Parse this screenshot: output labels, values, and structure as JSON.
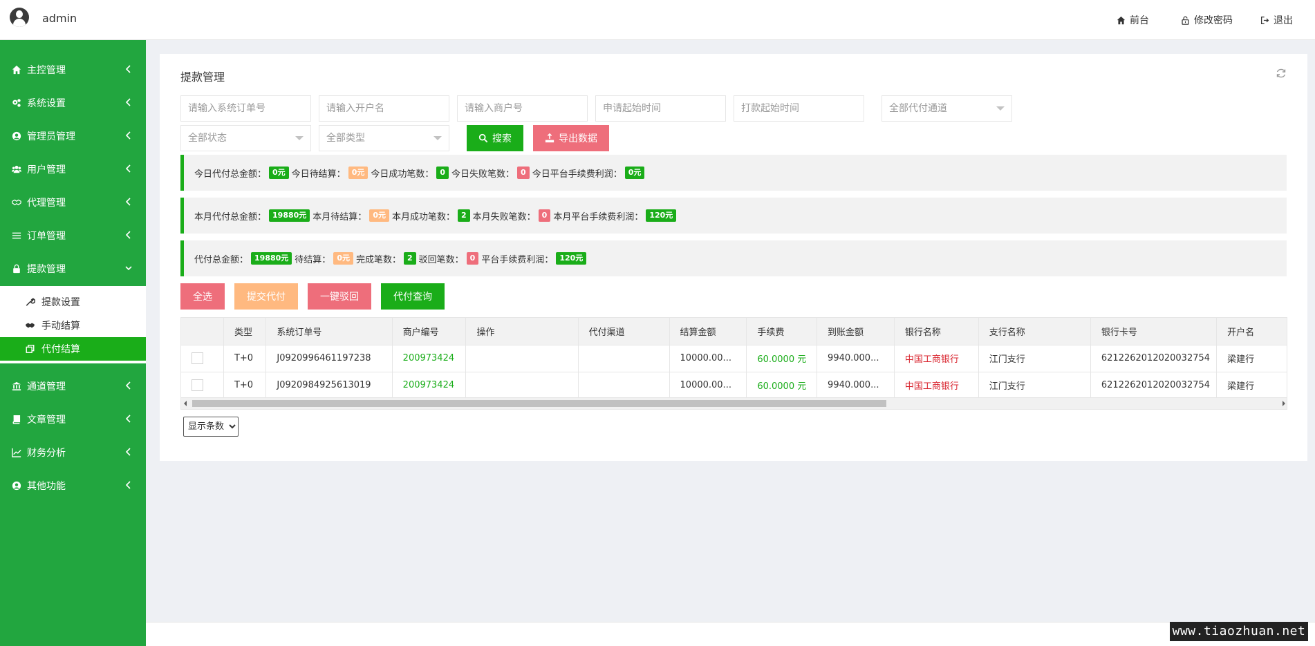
{
  "header": {
    "username": "admin",
    "links": [
      {
        "label": "前台",
        "icon": "home-icon"
      },
      {
        "label": "修改密码",
        "icon": "lock-icon"
      },
      {
        "label": "退出",
        "icon": "logout-icon"
      }
    ]
  },
  "sidebar": {
    "items": [
      {
        "label": "主控管理",
        "icon": "home-icon"
      },
      {
        "label": "系统设置",
        "icon": "gears-icon"
      },
      {
        "label": "管理员管理",
        "icon": "user-circle-icon"
      },
      {
        "label": "用户管理",
        "icon": "users-icon"
      },
      {
        "label": "代理管理",
        "icon": "handshake-icon"
      },
      {
        "label": "订单管理",
        "icon": "list-icon"
      },
      {
        "label": "提款管理",
        "icon": "lock-icon"
      },
      {
        "label": "通道管理",
        "icon": "bank-icon"
      },
      {
        "label": "文章管理",
        "icon": "book-icon"
      },
      {
        "label": "财务分析",
        "icon": "chart-icon"
      },
      {
        "label": "其他功能",
        "icon": "user-circle-icon"
      }
    ],
    "submenu": [
      {
        "label": "提款设置",
        "icon": "wrench-icon"
      },
      {
        "label": "手动结算",
        "icon": "handshake-icon"
      },
      {
        "label": "代付结算",
        "icon": "clone-icon"
      }
    ]
  },
  "panel": {
    "title": "提款管理"
  },
  "filters": {
    "order_no_placeholder": "请输入系统订单号",
    "account_name_placeholder": "请输入开户名",
    "merchant_no_placeholder": "请输入商户号",
    "apply_time_placeholder": "申请起始时间",
    "pay_time_placeholder": "打款起始时间",
    "channel_select": "全部代付通道",
    "status_select": "全部状态",
    "type_select": "全部类型",
    "search_label": "搜索",
    "export_label": "导出数据"
  },
  "stats": {
    "today": [
      {
        "label": "今日代付总金额：",
        "value": "0元",
        "color": "green"
      },
      {
        "label": "今日待结算：",
        "value": "0元",
        "color": "orange"
      },
      {
        "label": "今日成功笔数：",
        "value": "0",
        "color": "green"
      },
      {
        "label": "今日失败笔数：",
        "value": "0",
        "color": "red"
      },
      {
        "label": "今日平台手续费利润：",
        "value": "0元",
        "color": "green"
      }
    ],
    "month": [
      {
        "label": "本月代付总金额：",
        "value": "19880元",
        "color": "green"
      },
      {
        "label": "本月待结算：",
        "value": "0元",
        "color": "orange"
      },
      {
        "label": "本月成功笔数：",
        "value": "2",
        "color": "green"
      },
      {
        "label": "本月失败笔数：",
        "value": "0",
        "color": "red"
      },
      {
        "label": "本月平台手续费利润：",
        "value": "120元",
        "color": "green"
      }
    ],
    "total": [
      {
        "label": "代付总金额：",
        "value": "19880元",
        "color": "green"
      },
      {
        "label": "待结算：",
        "value": "0元",
        "color": "orange"
      },
      {
        "label": "完成笔数：",
        "value": "2",
        "color": "green"
      },
      {
        "label": "驳回笔数：",
        "value": "0",
        "color": "red"
      },
      {
        "label": "平台手续费利润：",
        "value": "120元",
        "color": "green"
      }
    ]
  },
  "actions": {
    "select_all": "全选",
    "submit_payout": "提交代付",
    "reject_all": "一键驳回",
    "payout_query": "代付查询"
  },
  "table": {
    "columns": [
      "",
      "类型",
      "系统订单号",
      "商户编号",
      "操作",
      "代付渠道",
      "结算金额",
      "手续费",
      "到账金额",
      "银行名称",
      "支行名称",
      "银行卡号",
      "开户名"
    ],
    "rows": [
      {
        "type": "T+0",
        "order_no": "J0920996461197238",
        "merchant_no": "200973424",
        "operation": "",
        "channel": "",
        "settle_amount": "10000.00...",
        "fee": "60.0000 元",
        "received": "9940.000...",
        "bank": "中国工商银行",
        "branch": "江门支行",
        "card_no": "6212262012020032754",
        "holder": "梁建行"
      },
      {
        "type": "T+0",
        "order_no": "J0920984925613019",
        "merchant_no": "200973424",
        "operation": "",
        "channel": "",
        "settle_amount": "10000.00...",
        "fee": "60.0000 元",
        "received": "9940.000...",
        "bank": "中国工商银行",
        "branch": "江门支行",
        "card_no": "6212262012020032754",
        "holder": "梁建行"
      }
    ]
  },
  "pagination": {
    "page_size_label": "显示条数"
  },
  "watermark": "www.tiaozhuan.net"
}
